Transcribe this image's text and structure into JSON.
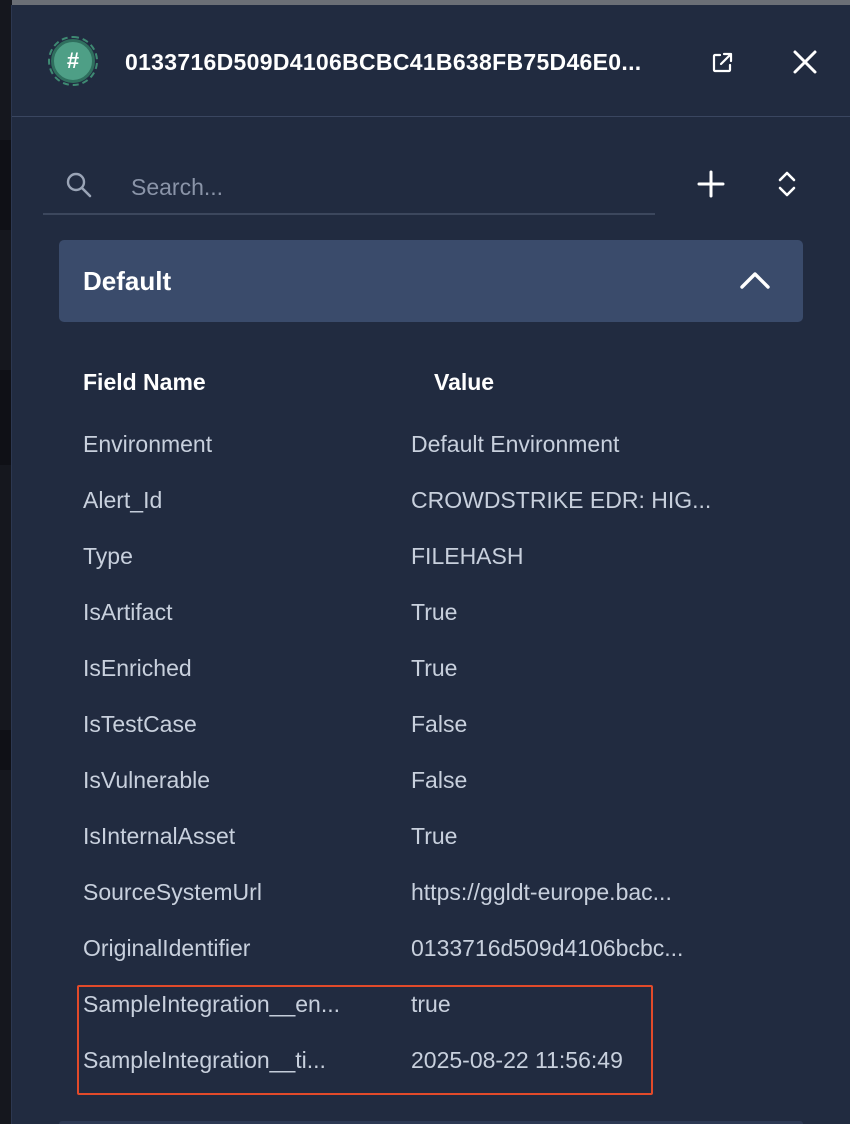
{
  "header": {
    "badge_symbol": "#",
    "title": "0133716D509D4106BCBC41B638FB75D46E0...",
    "icons": {
      "badge": "hash-icon",
      "open": "open-external-icon",
      "close": "close-icon"
    }
  },
  "search": {
    "placeholder": "Search...",
    "value": "",
    "icons": {
      "search": "search-icon",
      "add": "plus-icon",
      "sort": "sort-icon"
    }
  },
  "group": {
    "title": "Default",
    "expanded": true,
    "icon": "chevron-up-icon"
  },
  "table": {
    "headers": {
      "field": "Field Name",
      "value": "Value"
    },
    "rows": [
      {
        "name": "Environment",
        "value": "Default Environment"
      },
      {
        "name": "Alert_Id",
        "value": "CROWDSTRIKE EDR: HIG..."
      },
      {
        "name": "Type",
        "value": "FILEHASH"
      },
      {
        "name": "IsArtifact",
        "value": "True"
      },
      {
        "name": "IsEnriched",
        "value": "True"
      },
      {
        "name": "IsTestCase",
        "value": "False"
      },
      {
        "name": "IsVulnerable",
        "value": "False"
      },
      {
        "name": "IsInternalAsset",
        "value": "True"
      },
      {
        "name": "SourceSystemUrl",
        "value": "https://ggldt-europe.bac..."
      },
      {
        "name": "OriginalIdentifier",
        "value": "0133716d509d4106bcbc..."
      },
      {
        "name": "SampleIntegration__en...",
        "value": "true"
      },
      {
        "name": "SampleIntegration__ti...",
        "value": "2025-08-22 11:56:49"
      }
    ]
  },
  "colors": {
    "panel_bg": "#212b40",
    "group_header_bg": "#3a4b6b",
    "badge_green": "#4e9f86",
    "highlight": "#e24a2a"
  }
}
